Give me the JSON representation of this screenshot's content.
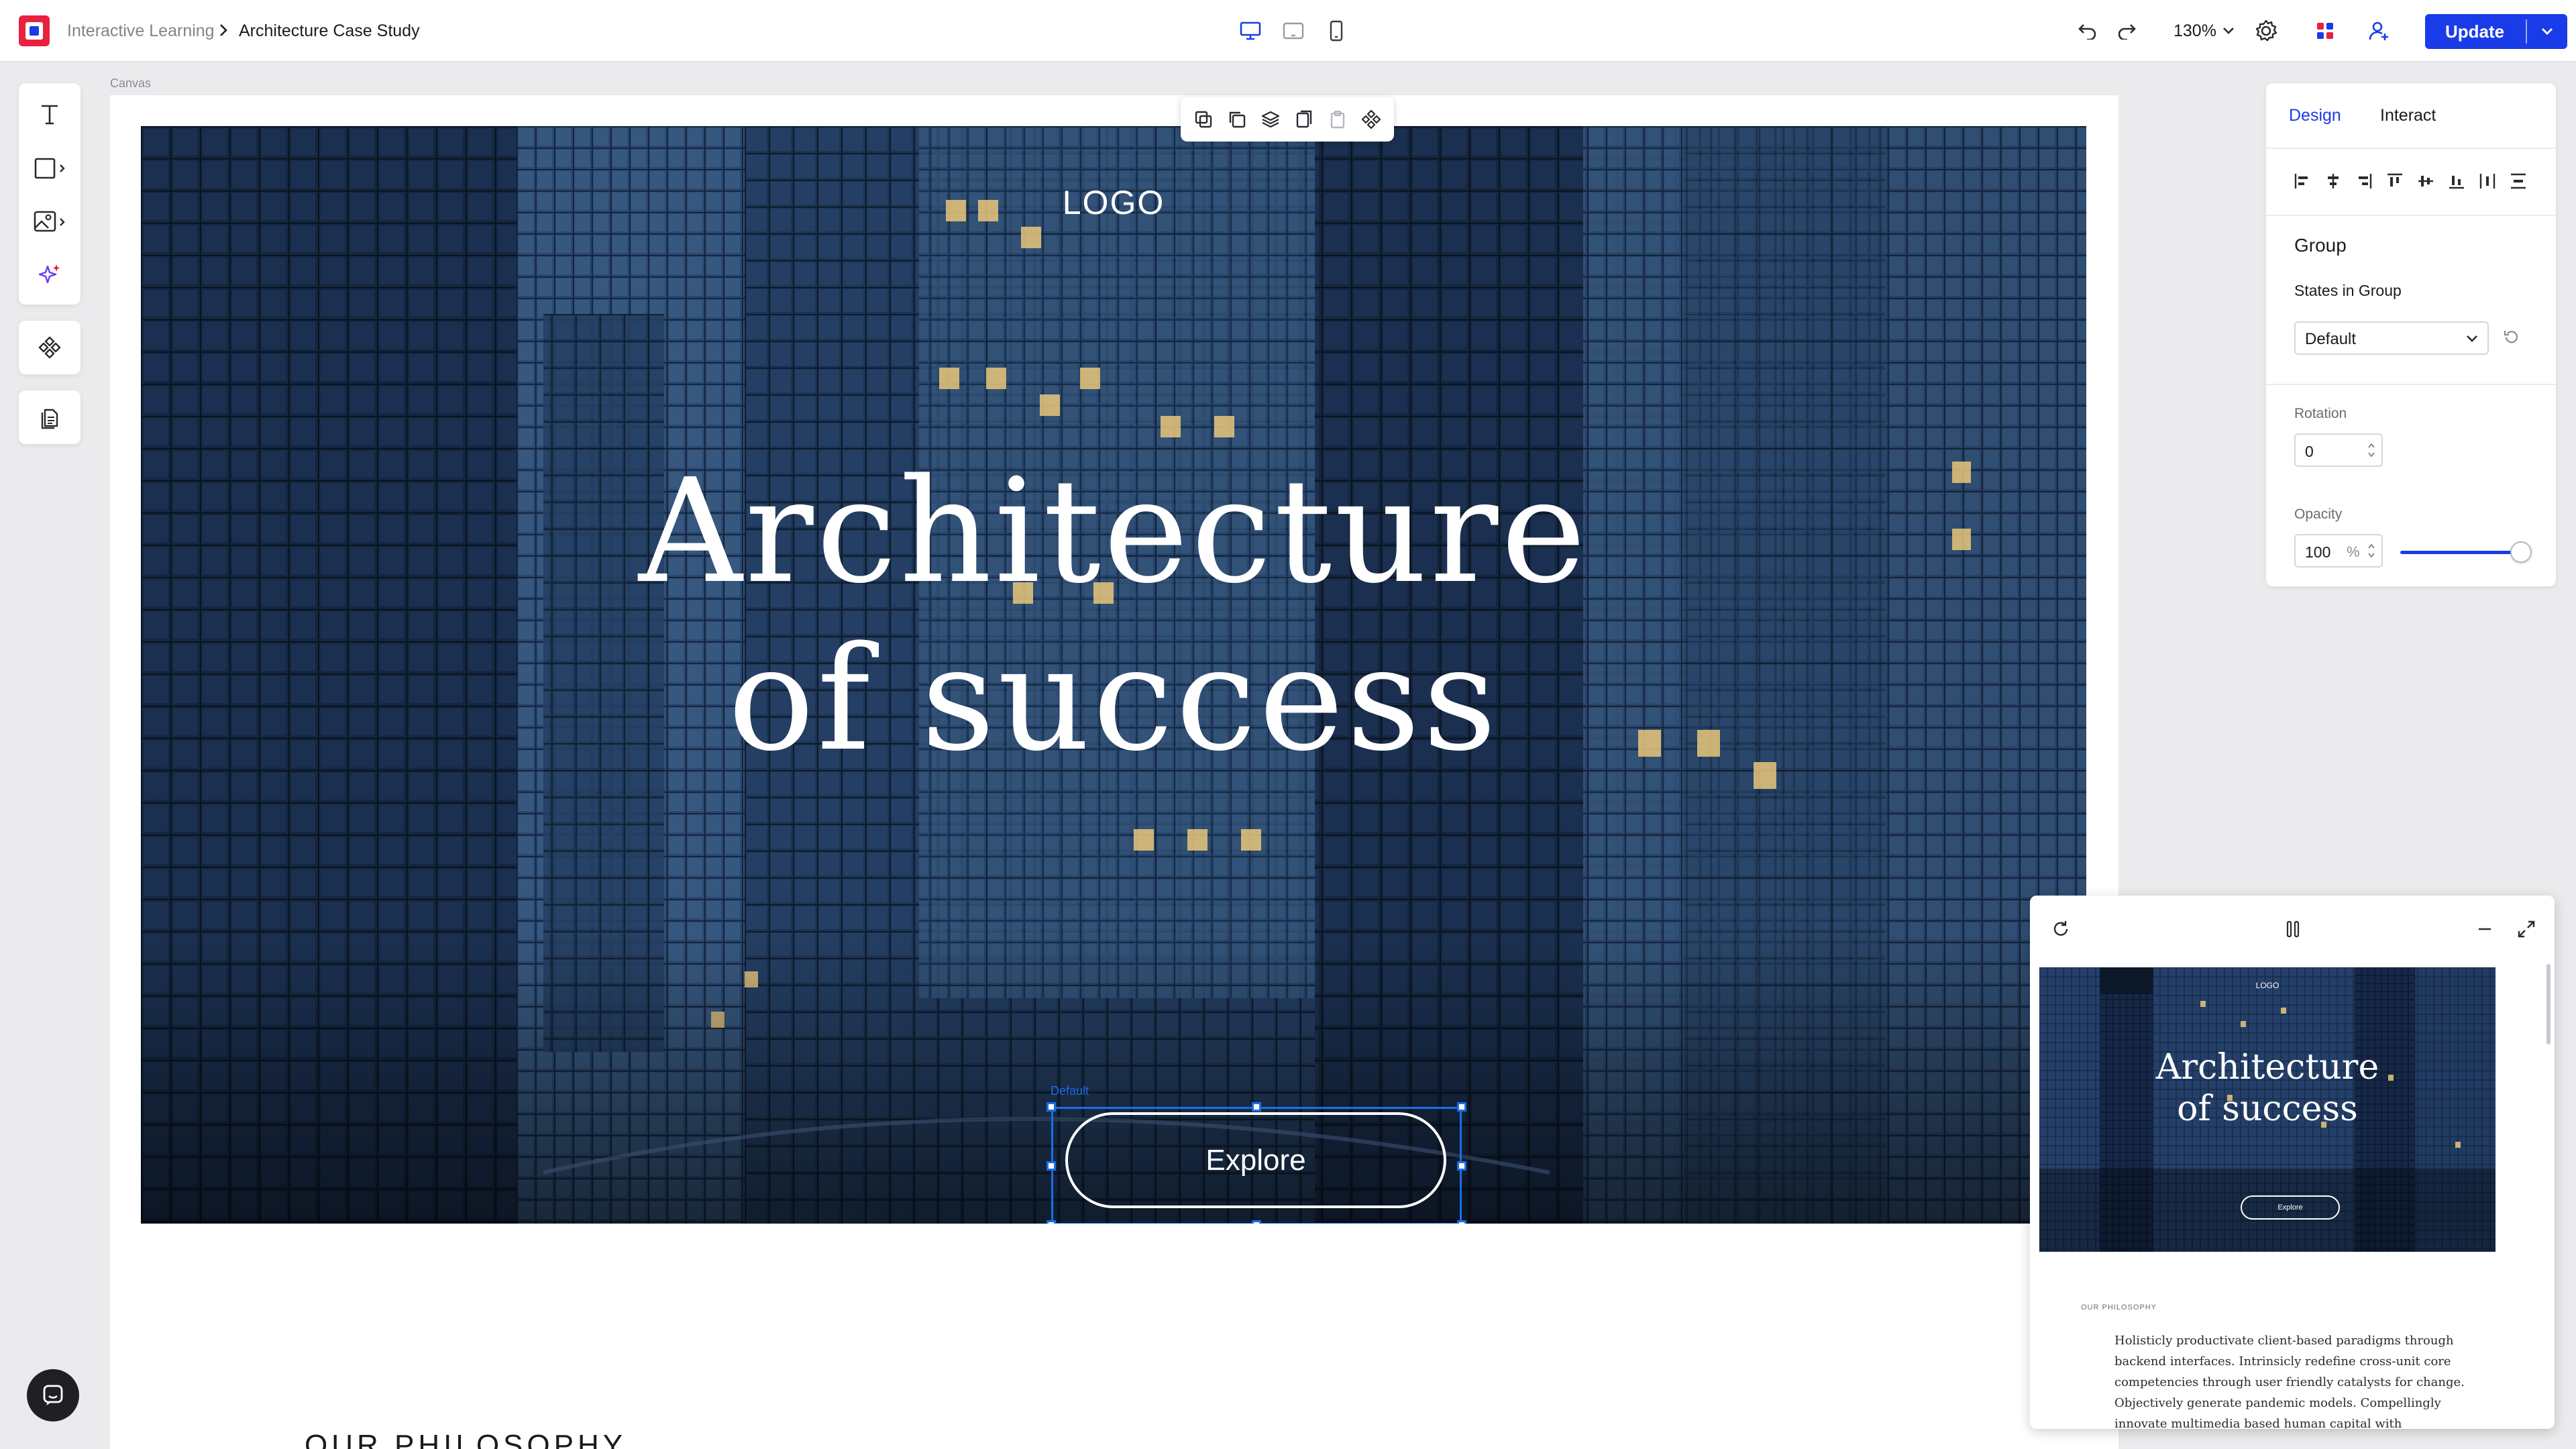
{
  "topbar": {
    "breadcrumb_parent": "Interactive Learning",
    "breadcrumb_current": "Architecture Case Study",
    "zoom": "130%",
    "update_label": "Update",
    "active_device": "desktop"
  },
  "left_tools": [
    {
      "name": "text-tool",
      "icon": "text-icon"
    },
    {
      "name": "shape-tool",
      "icon": "rectangle-icon"
    },
    {
      "name": "media-tool",
      "icon": "image-icon"
    },
    {
      "name": "ai-tool",
      "icon": "sparkle-icon"
    },
    {
      "name": "components-tool",
      "icon": "component-icon"
    },
    {
      "name": "pages-tool",
      "icon": "pages-icon"
    }
  ],
  "canvas": {
    "label": "Canvas",
    "hero": {
      "logo": "LOGO",
      "title_line1": "Architecture",
      "title_line2": "of success",
      "button_label": "Explore",
      "selection_state": "Default"
    },
    "section_heading": "OUR PHILOSOPHY"
  },
  "design_panel": {
    "tabs": [
      "Design",
      "Interact"
    ],
    "active_tab": "Design",
    "section_title": "Group",
    "states_label": "States in Group",
    "state_value": "Default",
    "rotation_label": "Rotation",
    "rotation_value": "0",
    "opacity_label": "Opacity",
    "opacity_value": "100",
    "opacity_unit": "%",
    "opacity_level": 1.0
  },
  "preview": {
    "logo": "LOGO",
    "title_line1": "Architecture",
    "title_line2": "of success",
    "button_label": "Explore",
    "section_label": "OUR PHILOSOPHY",
    "paragraph": "Holisticly productivate client-based paradigms through backend interfaces. Intrinsicly redefine cross-unit core competencies through user friendly catalysts for change. Objectively generate pandemic models. Compellingly innovate multimedia based human capital with"
  },
  "colors": {
    "accent": "#1a3ce8",
    "selection": "#1a6fe8",
    "hero_background": "#0e1a2c"
  }
}
